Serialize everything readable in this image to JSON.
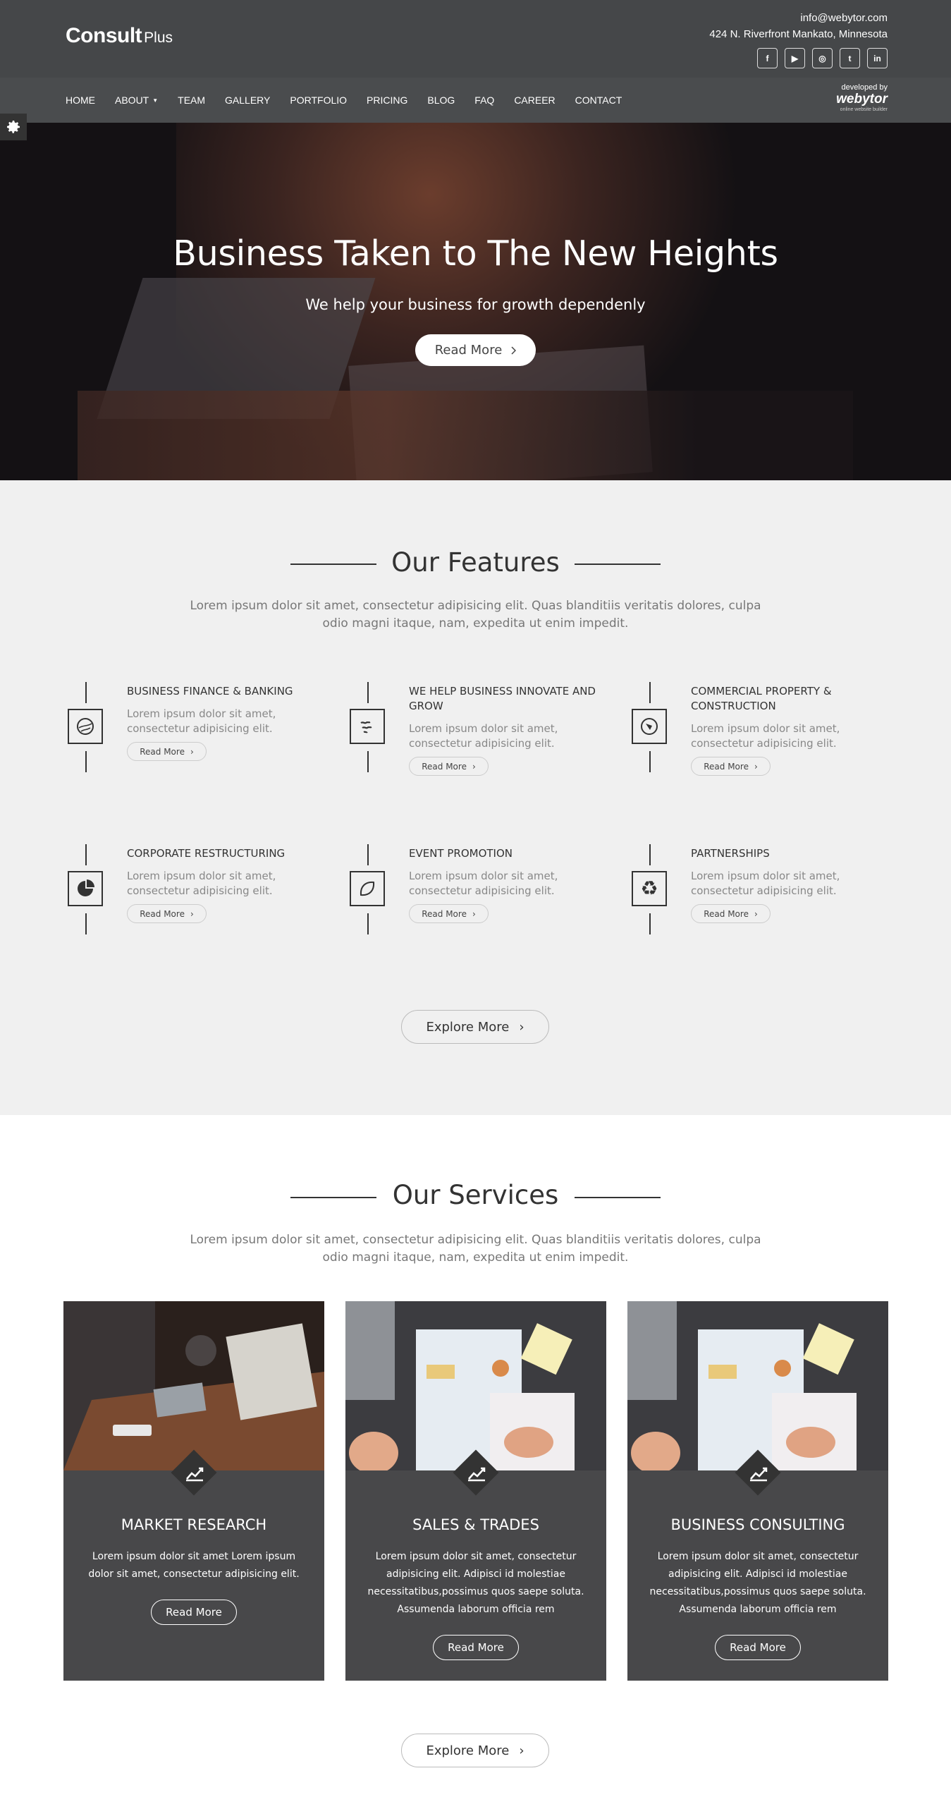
{
  "brand": {
    "name_bold": "Consult",
    "name_light": "Plus"
  },
  "contact": {
    "email": "info@webytor.com",
    "address": "424 N. Riverfront Mankato, Minnesota"
  },
  "socials": [
    {
      "icon": "facebook-icon",
      "glyph": "f"
    },
    {
      "icon": "youtube-icon",
      "glyph": "▶"
    },
    {
      "icon": "instagram-icon",
      "glyph": "◎"
    },
    {
      "icon": "twitter-icon",
      "glyph": "t"
    },
    {
      "icon": "linkedin-icon",
      "glyph": "in"
    }
  ],
  "nav": {
    "items": [
      "HOME",
      "ABOUT",
      "TEAM",
      "GALLERY",
      "PORTFOLIO",
      "PRICING",
      "BLOG",
      "FAQ",
      "CAREER",
      "CONTACT"
    ],
    "dropdown_caret": "▼"
  },
  "developer": {
    "label": "developed by",
    "brand": "webytor",
    "tagline": "online website builder"
  },
  "hero": {
    "title": "Business Taken to The New Heights",
    "subtitle": "We help your business for growth dependenly",
    "button": "Read More"
  },
  "features": {
    "title": "Our Features",
    "description": "Lorem ipsum dolor sit amet, consectetur adipisicing elit. Quas blanditiis veritatis dolores, culpa odio magni itaque, nam, expedita ut enim impedit.",
    "items": [
      {
        "title": "BUSINESS FINANCE & BANKING",
        "text": "Lorem ipsum dolor sit amet, consectetur adipisicing elit.",
        "button": "Read More",
        "icon": "globe-icon"
      },
      {
        "title": "WE HELP BUSINESS INNOVATE AND GROW",
        "text": "Lorem ipsum dolor sit amet, consectetur adipisicing elit.",
        "button": "Read More",
        "icon": "birds-icon"
      },
      {
        "title": "COMMERCIAL PROPERTY & CONSTRUCTION",
        "text": "Lorem ipsum dolor sit amet, consectetur adipisicing elit.",
        "button": "Read More",
        "icon": "compass-icon"
      },
      {
        "title": "CORPORATE RESTRUCTURING",
        "text": "Lorem ipsum dolor sit amet, consectetur adipisicing elit.",
        "button": "Read More",
        "icon": "pie-chart-icon"
      },
      {
        "title": "EVENT PROMOTION",
        "text": "Lorem ipsum dolor sit amet, consectetur adipisicing elit.",
        "button": "Read More",
        "icon": "leaf-icon"
      },
      {
        "title": "PARTNERSHIPS",
        "text": "Lorem ipsum dolor sit amet, consectetur adipisicing elit.",
        "button": "Read More",
        "icon": "recycle-icon"
      }
    ],
    "explore": "Explore More"
  },
  "services": {
    "title": "Our Services",
    "description": "Lorem ipsum dolor sit amet, consectetur adipisicing elit. Quas blanditiis veritatis dolores, culpa odio magni itaque, nam, expedita ut enim impedit.",
    "items": [
      {
        "title": "MARKET RESEARCH",
        "text": "Lorem ipsum dolor sit amet Lorem ipsum dolor sit amet, consectetur adipisicing elit.",
        "button": "Read More",
        "icon": "trend-up-icon"
      },
      {
        "title": "SALES & TRADES",
        "text": "Lorem ipsum dolor sit amet, consectetur adipisicing elit. Adipisci id molestiae necessitatibus,possimus quos saepe soluta. Assumenda laborum officia rem",
        "button": "Read More",
        "icon": "trend-up-icon"
      },
      {
        "title": "BUSINESS CONSULTING",
        "text": "Lorem ipsum dolor sit amet, consectetur adipisicing elit. Adipisci id molestiae necessitatibus,possimus quos saepe soluta. Assumenda laborum officia rem",
        "button": "Read More",
        "icon": "trend-up-icon"
      }
    ],
    "explore": "Explore More"
  },
  "colors": {
    "header": "#454749",
    "nav": "#4a4c4e",
    "features_bg": "#f0f0f0",
    "card": "#48484a"
  }
}
